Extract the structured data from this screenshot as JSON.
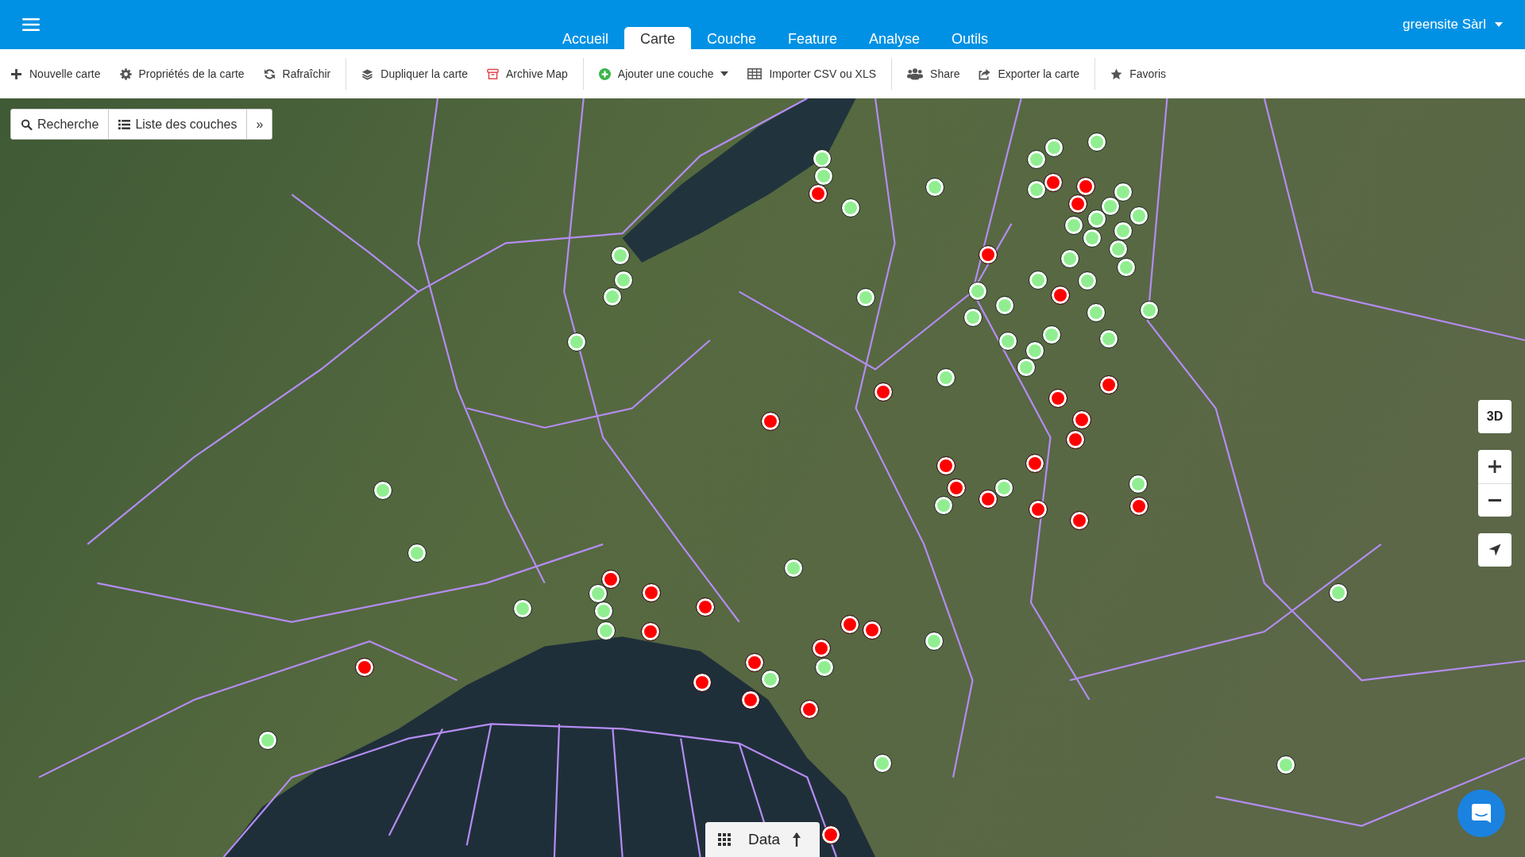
{
  "header": {
    "tabs": [
      {
        "label": "Accueil",
        "selected": false
      },
      {
        "label": "Carte",
        "selected": true
      },
      {
        "label": "Couche",
        "selected": false
      },
      {
        "label": "Feature",
        "selected": false
      },
      {
        "label": "Analyse",
        "selected": false
      },
      {
        "label": "Outils",
        "selected": false
      }
    ],
    "user_menu": "greensite Sàrl"
  },
  "toolbar": {
    "groups": [
      {
        "items": [
          {
            "label": "Nouvelle carte",
            "dropdown": false
          },
          {
            "label": "Propriétés de la carte",
            "dropdown": false
          },
          {
            "label": "Rafraîchir",
            "dropdown": false
          }
        ]
      },
      {
        "items": [
          {
            "label": "Dupliquer la carte",
            "dropdown": false
          },
          {
            "label": "Archive Map",
            "dropdown": false
          }
        ]
      },
      {
        "items": [
          {
            "label": "Ajouter une couche",
            "dropdown": true
          },
          {
            "label": "Importer CSV ou XLS",
            "dropdown": false
          }
        ]
      },
      {
        "items": [
          {
            "label": "Share",
            "dropdown": false
          },
          {
            "label": "Exporter la carte",
            "dropdown": false
          }
        ]
      },
      {
        "items": [
          {
            "label": "Favoris",
            "dropdown": false
          }
        ]
      }
    ]
  },
  "map_search": {
    "search_button": "Recherche",
    "layers_button": "Liste des couches",
    "expand_button": "»"
  },
  "map_controls": {
    "view_3d_button": "3D"
  },
  "markers": [
    {
      "color": "#90ee90"
    },
    {
      "color": "#90ee90"
    },
    {
      "color": "#90ee90"
    },
    {
      "color": "#90ee90"
    },
    {
      "color": "#ff0000"
    },
    {
      "color": "#90ee90"
    },
    {
      "color": "#ff0000"
    },
    {
      "color": "#90ee90"
    },
    {
      "color": "#90ee90"
    },
    {
      "color": "#ff0000"
    },
    {
      "color": "#90ee90"
    },
    {
      "color": "#ff0000"
    },
    {
      "color": "#90ee90"
    },
    {
      "color": "#90ee90"
    },
    {
      "color": "#90ee90"
    },
    {
      "color": "#90ee90"
    },
    {
      "color": "#90ee90"
    },
    {
      "color": "#90ee90"
    },
    {
      "color": "#90ee90"
    },
    {
      "color": "#90ee90"
    },
    {
      "color": "#ff0000"
    },
    {
      "color": "#90ee90"
    },
    {
      "color": "#90ee90"
    },
    {
      "color": "#90ee90"
    },
    {
      "color": "#90ee90"
    },
    {
      "color": "#90ee90"
    },
    {
      "color": "#90ee90"
    },
    {
      "color": "#90ee90"
    },
    {
      "color": "#90ee90"
    },
    {
      "color": "#ff0000"
    },
    {
      "color": "#90ee90"
    },
    {
      "color": "#90ee90"
    },
    {
      "color": "#90ee90"
    },
    {
      "color": "#90ee90"
    },
    {
      "color": "#90ee90"
    },
    {
      "color": "#90ee90"
    },
    {
      "color": "#90ee90"
    },
    {
      "color": "#90ee90"
    },
    {
      "color": "#90ee90"
    },
    {
      "color": "#90ee90"
    },
    {
      "color": "#90ee90"
    },
    {
      "color": "#90ee90"
    },
    {
      "color": "#ff0000"
    },
    {
      "color": "#ff0000"
    },
    {
      "color": "#ff0000"
    },
    {
      "color": "#ff0000"
    },
    {
      "color": "#ff0000"
    },
    {
      "color": "#ff0000"
    },
    {
      "color": "#ff0000"
    },
    {
      "color": "#ff0000"
    },
    {
      "color": "#90ee90"
    },
    {
      "color": "#90ee90"
    },
    {
      "color": "#ff0000"
    },
    {
      "color": "#ff0000"
    },
    {
      "color": "#90ee90"
    },
    {
      "color": "#90ee90"
    },
    {
      "color": "#ff0000"
    },
    {
      "color": "#ff0000"
    },
    {
      "color": "#ff0000"
    },
    {
      "color": "#90ee90"
    },
    {
      "color": "#90ee90"
    },
    {
      "color": "#ff0000"
    },
    {
      "color": "#90ee90"
    },
    {
      "color": "#ff0000"
    },
    {
      "color": "#90ee90"
    },
    {
      "color": "#90ee90"
    },
    {
      "color": "#ff0000"
    },
    {
      "color": "#90ee90"
    },
    {
      "color": "#ff0000"
    },
    {
      "color": "#ff0000"
    },
    {
      "color": "#90ee90"
    },
    {
      "color": "#ff0000"
    },
    {
      "color": "#90ee90"
    },
    {
      "color": "#ff0000"
    },
    {
      "color": "#ff0000"
    },
    {
      "color": "#90ee90"
    },
    {
      "color": "#ff0000"
    },
    {
      "color": "#90ee90"
    },
    {
      "color": "#ff0000"
    },
    {
      "color": "#ff0000"
    },
    {
      "color": "#ff0000"
    },
    {
      "color": "#90ee90"
    },
    {
      "color": "#90ee90"
    },
    {
      "color": "#90ee90"
    },
    {
      "color": "#ff0000"
    }
  ],
  "data_panel": {
    "label": "Data"
  }
}
